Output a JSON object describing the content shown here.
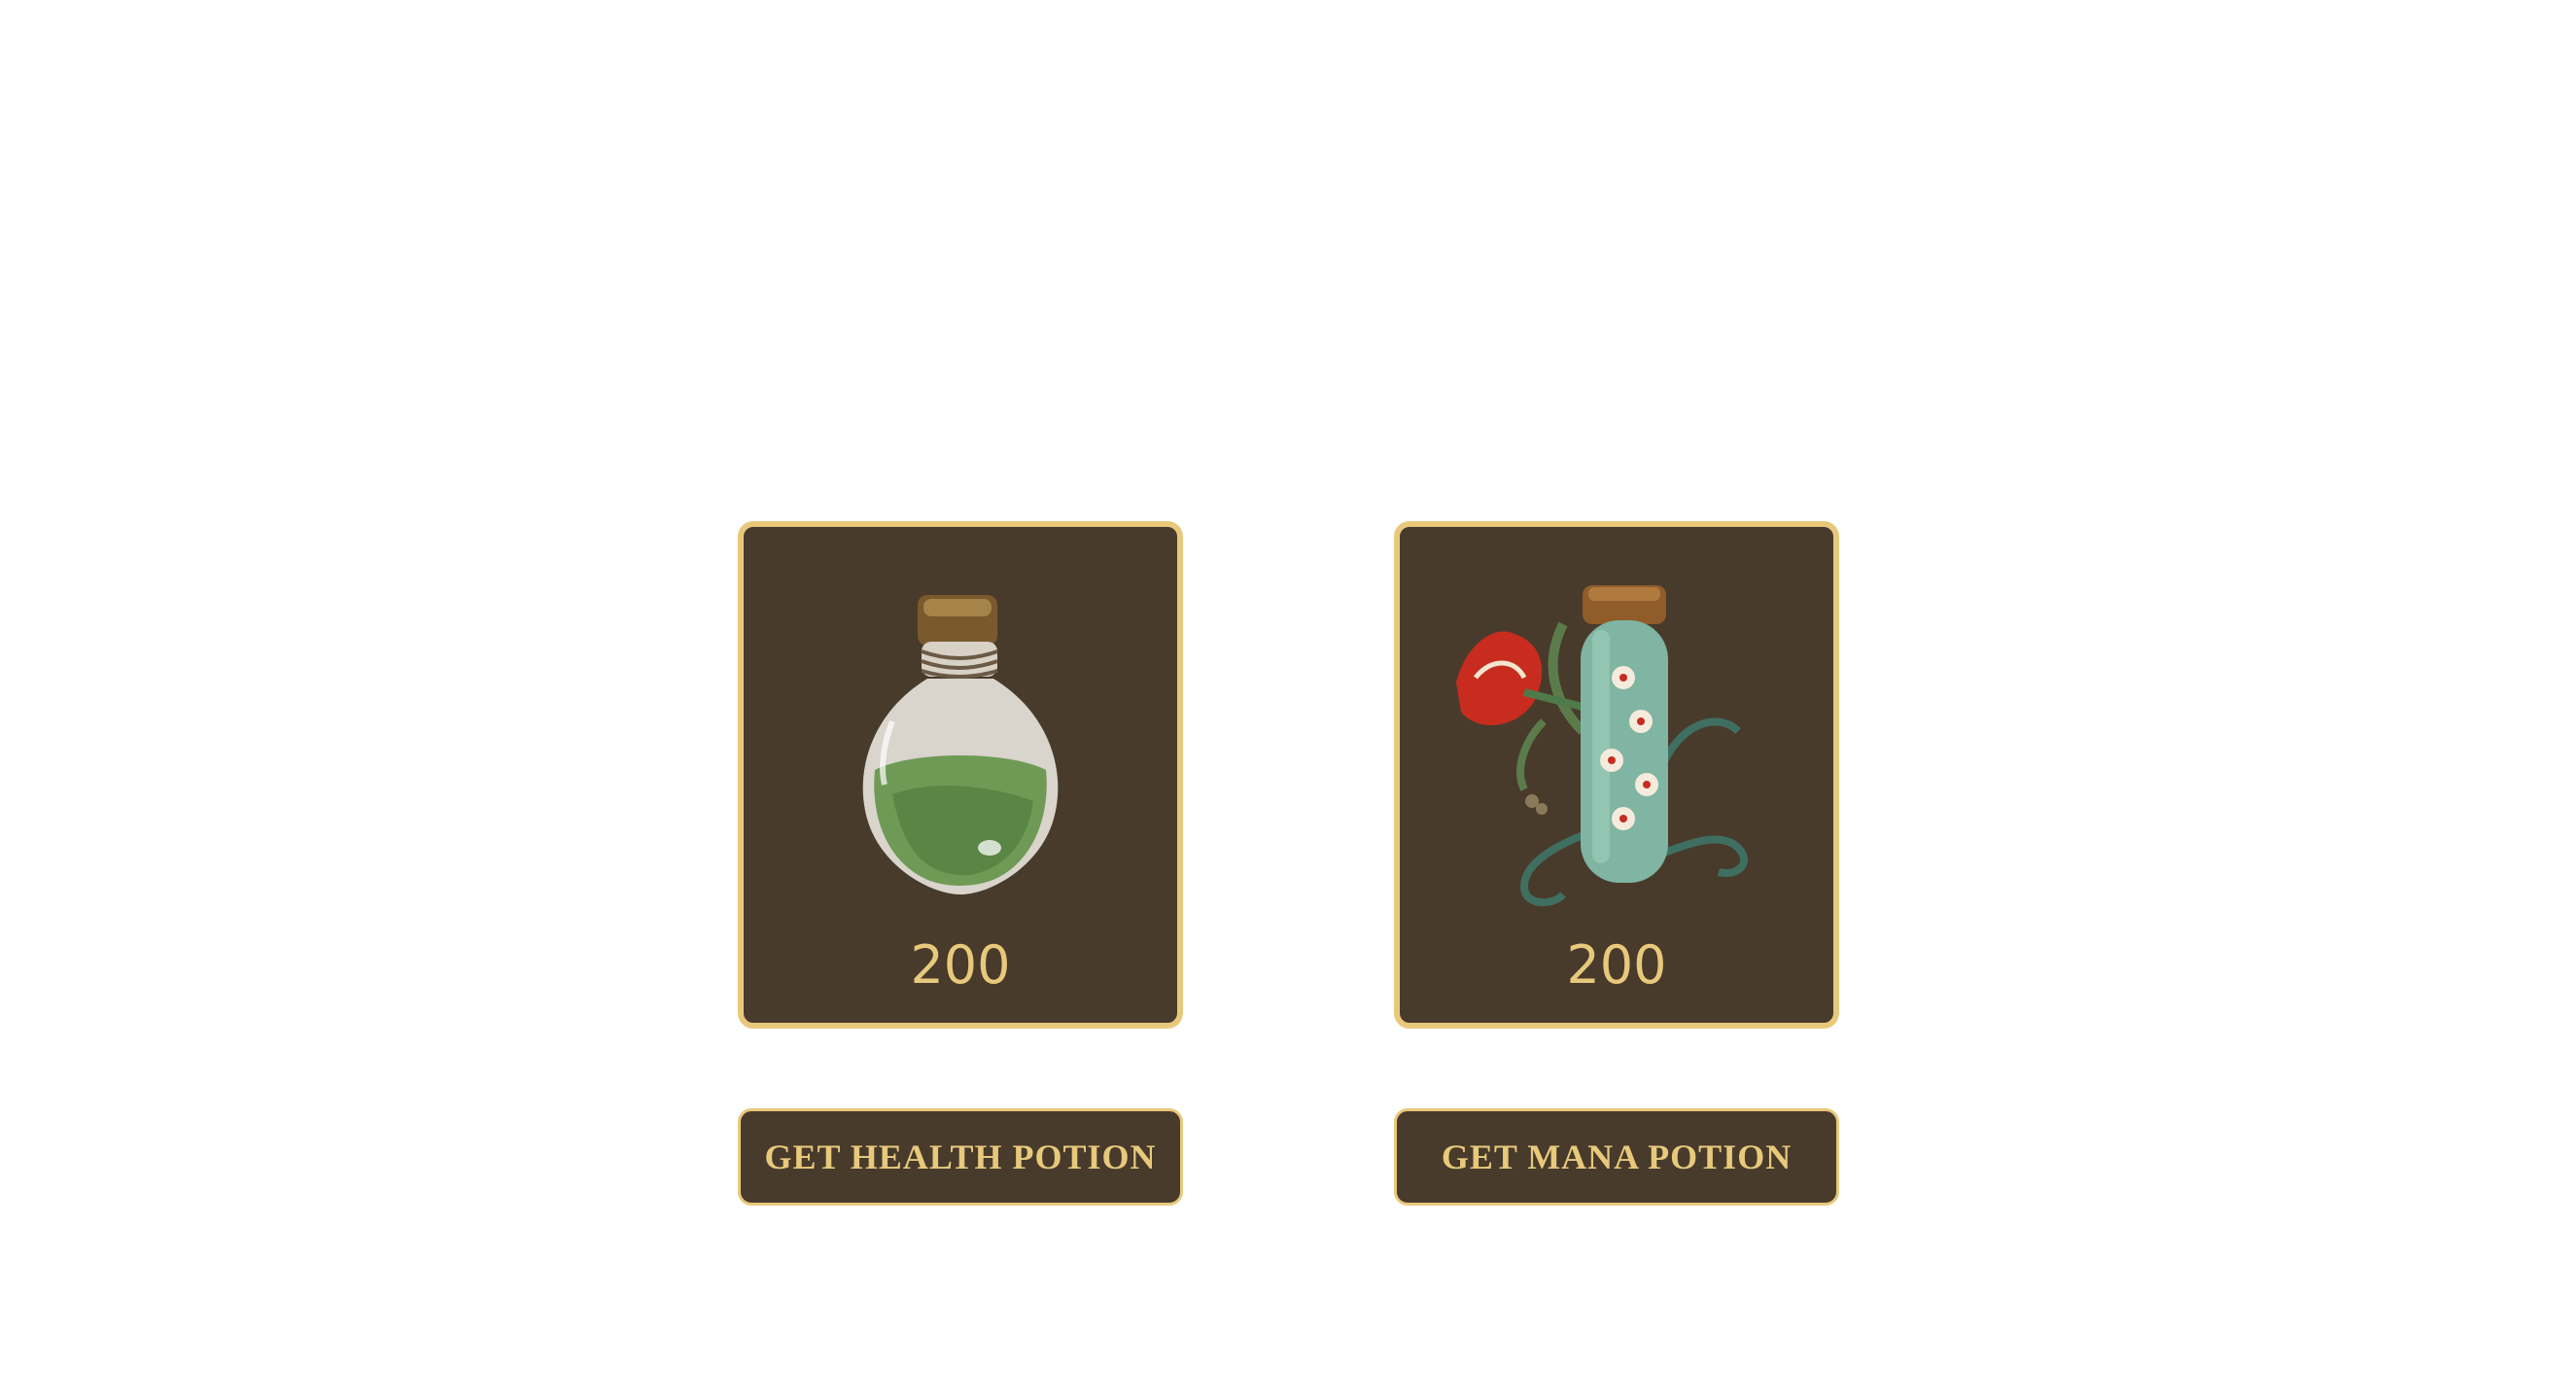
{
  "shop": {
    "items": [
      {
        "id": "health",
        "icon": "green-potion-bottle-icon",
        "price": "200",
        "button_label": "GET HEALTH POTION"
      },
      {
        "id": "mana",
        "icon": "floral-vial-icon",
        "price": "200",
        "button_label": "GET MANA POTION"
      }
    ]
  },
  "colors": {
    "card_background": "#483b2c",
    "accent_gold": "#e8c97c",
    "page_background": "#ffffff"
  }
}
